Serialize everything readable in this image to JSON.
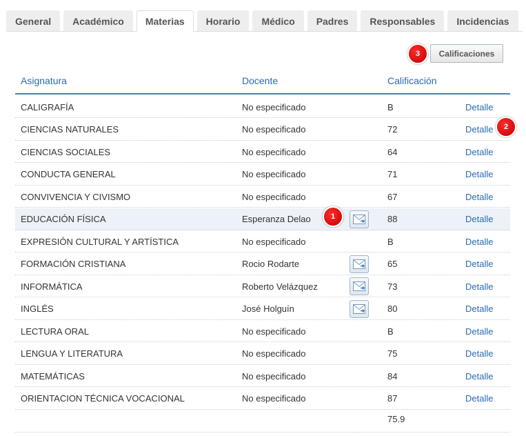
{
  "tabs": [
    {
      "label": "General"
    },
    {
      "label": "Académico"
    },
    {
      "label": "Materias",
      "active": true
    },
    {
      "label": "Horario"
    },
    {
      "label": "Médico"
    },
    {
      "label": "Padres"
    },
    {
      "label": "Responsables"
    },
    {
      "label": "Incidencias"
    }
  ],
  "toolbar": {
    "calificaciones_label": "Calificaciones"
  },
  "badges": {
    "one": "1",
    "two": "2",
    "three": "3"
  },
  "table": {
    "headers": {
      "subject": "Asignatura",
      "teacher": "Docente",
      "grade": "Calificación"
    },
    "rows": [
      {
        "subject": "CALIGRAFÍA",
        "teacher": "No especificado",
        "grade": "B",
        "detail": "Detalle"
      },
      {
        "subject": "CIENCIAS NATURALES",
        "teacher": "No especificado",
        "grade": "72",
        "detail": "Detalle"
      },
      {
        "subject": "CIENCIAS SOCIALES",
        "teacher": "No especificado",
        "grade": "64",
        "detail": "Detalle"
      },
      {
        "subject": "CONDUCTA GENERAL",
        "teacher": "No especificado",
        "grade": "71",
        "detail": "Detalle"
      },
      {
        "subject": "CONVIVENCIA Y CIVISMO",
        "teacher": "No especificado",
        "grade": "67",
        "detail": "Detalle"
      },
      {
        "subject": "EDUCACIÓN FÍSICA",
        "teacher": "Esperanza Delao",
        "grade": "88",
        "detail": "Detalle",
        "mail": true,
        "highlight": true
      },
      {
        "subject": "EXPRESIÓN CULTURAL Y ARTÍSTICA",
        "teacher": "No especificado",
        "grade": "B",
        "detail": "Detalle"
      },
      {
        "subject": "FORMACIÓN CRISTIANA",
        "teacher": "Rocio Rodarte",
        "grade": "65",
        "detail": "Detalle",
        "mail": true
      },
      {
        "subject": "INFORMÁTICA",
        "teacher": "Roberto Velázquez",
        "grade": "73",
        "detail": "Detalle",
        "mail": true
      },
      {
        "subject": "INGLÉS",
        "teacher": "José Holguín",
        "grade": "80",
        "detail": "Detalle",
        "mail": true
      },
      {
        "subject": "LECTURA ORAL",
        "teacher": "No especificado",
        "grade": "B",
        "detail": "Detalle"
      },
      {
        "subject": "LENGUA Y LITERATURA",
        "teacher": "No especificado",
        "grade": "75",
        "detail": "Detalle"
      },
      {
        "subject": "MATEMÁTICAS",
        "teacher": "No especificado",
        "grade": "84",
        "detail": "Detalle"
      },
      {
        "subject": "ORIENTACION TÉCNICA VOCACIONAL",
        "teacher": "No especificado",
        "grade": "87",
        "detail": "Detalle"
      }
    ],
    "average": "75.9"
  },
  "icons": {
    "mail": "envelope-icon"
  },
  "colors": {
    "link": "#2a6ab0",
    "header_rule": "#4a7ebb",
    "badge": "#d40000",
    "highlight_row": "#edf2f8"
  }
}
